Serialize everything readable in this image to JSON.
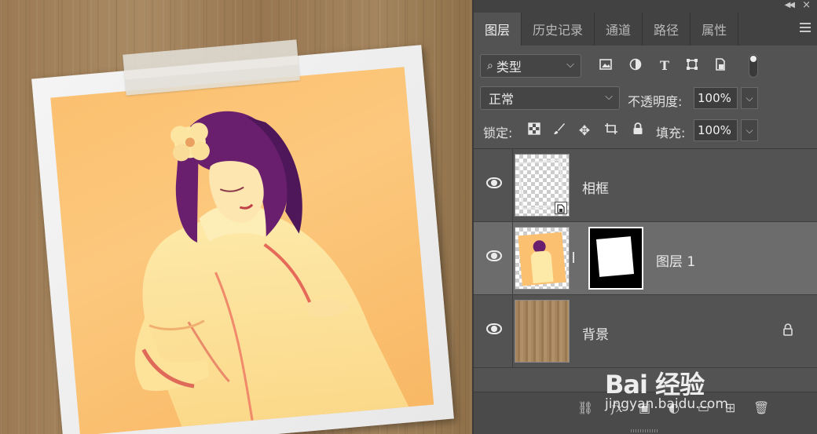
{
  "panel": {
    "tabs": [
      {
        "label": "图层",
        "active": true
      },
      {
        "label": "历史记录"
      },
      {
        "label": "通道"
      },
      {
        "label": "路径"
      },
      {
        "label": "属性"
      }
    ],
    "filter": {
      "label": "类型",
      "icons": [
        "image-filter-icon",
        "adjustment-filter-icon",
        "type-filter-icon",
        "shape-filter-icon",
        "smart-object-filter-icon",
        "filter-toggle"
      ]
    },
    "blend_mode": "正常",
    "opacity_label": "不透明度:",
    "opacity_value": "100%",
    "lock_label": "锁定:",
    "fill_label": "填充:",
    "fill_value": "100%",
    "layers": [
      {
        "name": "相框",
        "visible": true,
        "type": "smart-object"
      },
      {
        "name": "图层 1",
        "visible": true,
        "selected": true,
        "has_mask": true
      },
      {
        "name": "背景",
        "visible": true,
        "locked": true
      }
    ],
    "footer_fx": "fx"
  },
  "watermark": {
    "logo": "Bai 经验",
    "url": "jingyan.baidu.com"
  },
  "colors": {
    "panel_bg": "#535353",
    "tab_bar": "#424242",
    "selected_layer": "#6c6c6c",
    "photo_orange": "#fbc070"
  }
}
